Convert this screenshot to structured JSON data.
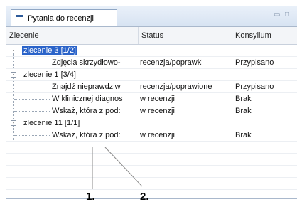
{
  "panel": {
    "tab_title": "Pytania do recenzji",
    "icons": [
      "tab-icon",
      "minimize-icon",
      "maximize-icon"
    ]
  },
  "table": {
    "columns": [
      "Zlecenie",
      "Status",
      "Konsylium"
    ],
    "rows": [
      {
        "kind": "group",
        "toggle": "-",
        "label": "zlecenie 3 [1/2]",
        "selected": true
      },
      {
        "kind": "item",
        "label": "Zdjęcia skrzydłowo-",
        "status": "recenzja/poprawki",
        "konsylium": "Przypisano"
      },
      {
        "kind": "group",
        "toggle": "-",
        "label": "zlecenie 1 [3/4]"
      },
      {
        "kind": "item",
        "label": "Znajdź nieprawdziw",
        "status": "recenzja/poprawione",
        "konsylium": "Przypisano"
      },
      {
        "kind": "item",
        "label": "W klinicznej diagnos",
        "status": "w recenzji",
        "konsylium": "Brak"
      },
      {
        "kind": "item",
        "label": "Wskaż, która z pod:",
        "status": "w recenzji",
        "konsylium": "Brak"
      },
      {
        "kind": "group",
        "toggle": "-",
        "label": "zlecenie 11 [1/1]"
      },
      {
        "kind": "item",
        "label": "Wskaż, która z pod:",
        "status": "w recenzji",
        "konsylium": "Brak"
      }
    ]
  },
  "annotations": {
    "label_1": "1.",
    "label_2": "2."
  }
}
